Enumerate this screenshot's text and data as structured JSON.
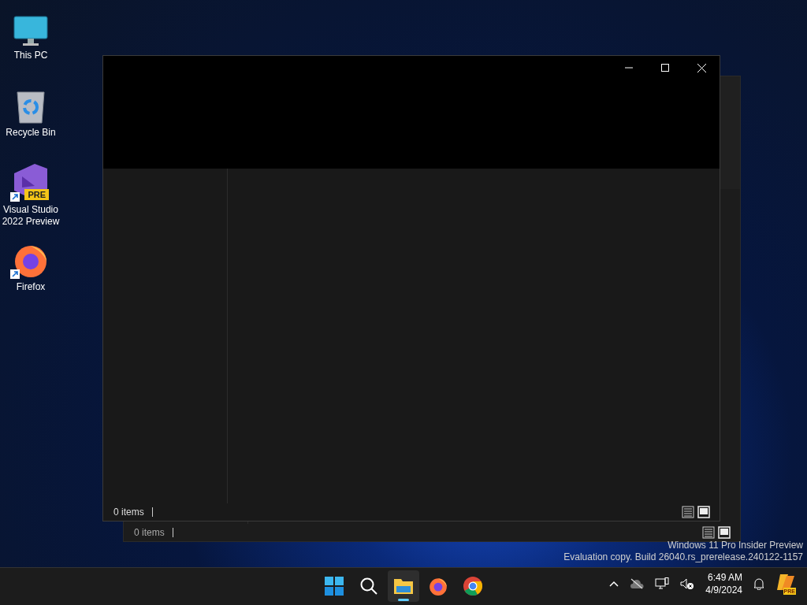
{
  "desktop_icons": [
    {
      "kind": "pc",
      "label": "This PC",
      "shortcut": false
    },
    {
      "kind": "bin",
      "label": "Recycle Bin",
      "shortcut": false
    },
    {
      "kind": "vs",
      "label": "Visual Studio 2022 Preview",
      "shortcut": true,
      "badge": "PRE"
    },
    {
      "kind": "firefox",
      "label": "Firefox",
      "shortcut": true
    }
  ],
  "windows": [
    {
      "status": "0 items",
      "focused": false
    },
    {
      "status": "0 items",
      "focused": true
    }
  ],
  "watermark": [
    "Windows 11 Pro Insider Preview",
    "Evaluation copy. Build 26040.rs_prerelease.240122-1157"
  ],
  "taskbar": [
    {
      "kind": "start",
      "running": false
    },
    {
      "kind": "search",
      "running": false
    },
    {
      "kind": "explorer",
      "running": true
    },
    {
      "kind": "firefox",
      "running": false
    },
    {
      "kind": "chrome",
      "running": false
    }
  ],
  "tray": {
    "time": "6:49 AM",
    "date": "4/9/2024",
    "copilot_badge": "PRE"
  }
}
